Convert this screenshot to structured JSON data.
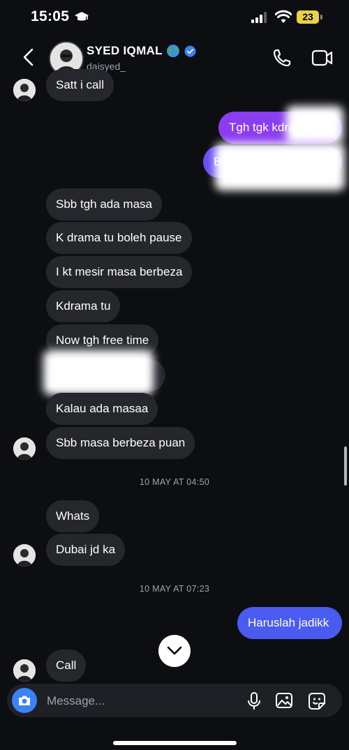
{
  "status_bar": {
    "time": "15:05",
    "battery": "23"
  },
  "header": {
    "name": "SYED IQMAL",
    "handle": "daisyed_"
  },
  "messages": {
    "m1": "Satt i call",
    "m2": "Tgh tgk kdrama",
    "m3": "B",
    "m4": "Sbb tgh ada masa",
    "m5": "K drama tu boleh pause",
    "m6": "I kt mesir masa berbeza",
    "m7": "Kdrama tu",
    "m8": "Now tgh free time",
    "m9": "",
    "m10": "Kalau ada masaa",
    "m11": "Sbb masa berbeza puan",
    "m12": "Whats",
    "m13": "Dubai jd ka",
    "m14": "Haruslah jadikk",
    "m15": "Call"
  },
  "timestamps": {
    "t1": "10 MAY AT 04:50",
    "t2": "10 MAY AT 07:23"
  },
  "composer": {
    "placeholder": "Message..."
  },
  "colors": {
    "outgoing_bubble": "#4a5bf0",
    "gradient_top": "#8b3df0",
    "incoming_bubble": "#25272c",
    "background": "#0c0e12",
    "accent": "#3b82f6"
  },
  "icons": [
    "graduation-cap-icon",
    "signal-icon",
    "wifi-icon",
    "back-icon",
    "globe-icon",
    "verified-icon",
    "phone-icon",
    "video-icon",
    "chevron-down-icon",
    "camera-icon",
    "mic-icon",
    "gallery-icon",
    "sticker-icon"
  ]
}
